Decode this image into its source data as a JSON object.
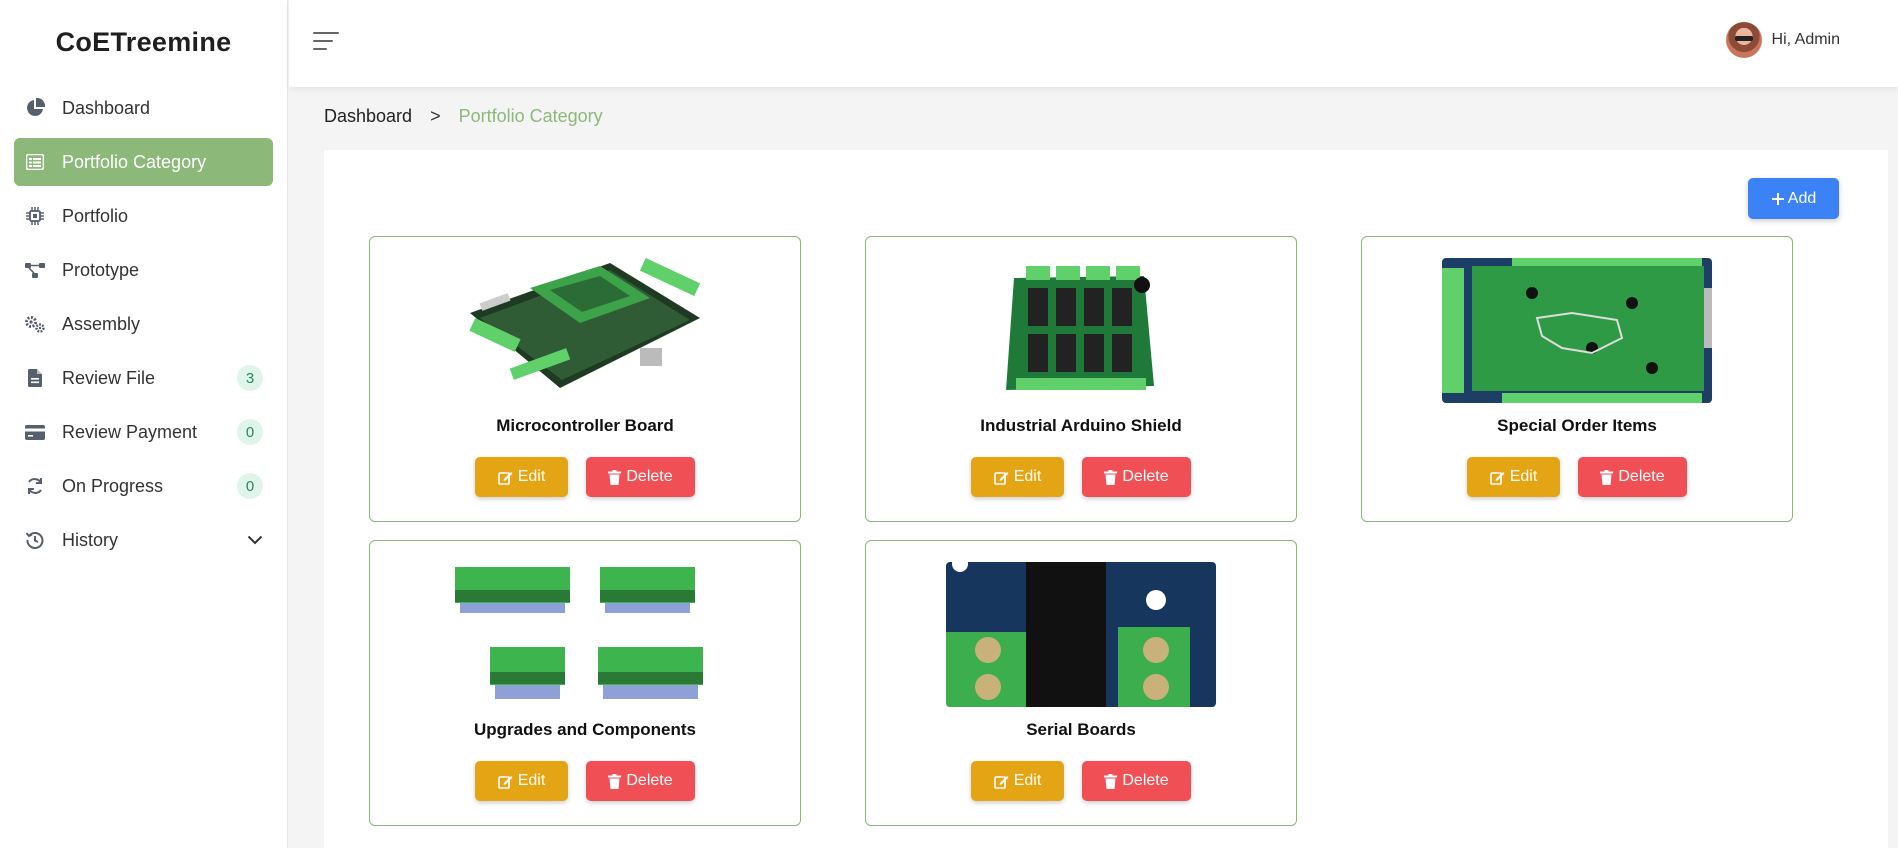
{
  "app": {
    "brand": "CoETreemine"
  },
  "sidebar": {
    "items": [
      {
        "label": "Dashboard",
        "icon": "pie-chart-icon",
        "badge": null
      },
      {
        "label": "Portfolio Category",
        "icon": "table-list-icon",
        "badge": null,
        "active": true
      },
      {
        "label": "Portfolio",
        "icon": "chip-icon",
        "badge": null
      },
      {
        "label": "Prototype",
        "icon": "nodes-icon",
        "badge": null
      },
      {
        "label": "Assembly",
        "icon": "gears-icon",
        "badge": null
      },
      {
        "label": "Review File",
        "icon": "file-icon",
        "badge": "3"
      },
      {
        "label": "Review Payment",
        "icon": "credit-card-icon",
        "badge": "0"
      },
      {
        "label": "On Progress",
        "icon": "refresh-icon",
        "badge": "0"
      },
      {
        "label": "History",
        "icon": "history-icon",
        "badge": null
      }
    ]
  },
  "topbar": {
    "user_greeting": "Hi, Admin"
  },
  "breadcrumb": {
    "home": "Dashboard",
    "separator": ">",
    "current": "Portfolio Category"
  },
  "actions": {
    "add_label": "Add"
  },
  "cards": [
    {
      "title": "Microcontroller Board",
      "edit_label": "Edit",
      "delete_label": "Delete"
    },
    {
      "title": "Industrial Arduino Shield",
      "edit_label": "Edit",
      "delete_label": "Delete"
    },
    {
      "title": "Special Order Items",
      "edit_label": "Edit",
      "delete_label": "Delete"
    },
    {
      "title": "Upgrades and Components",
      "edit_label": "Edit",
      "delete_label": "Delete"
    },
    {
      "title": "Serial Boards",
      "edit_label": "Edit",
      "delete_label": "Delete"
    }
  ],
  "colors": {
    "accent_green": "#8cb87a",
    "primary_blue": "#3b82f6",
    "edit_amber": "#e3a514",
    "delete_red": "#ef4f55"
  }
}
